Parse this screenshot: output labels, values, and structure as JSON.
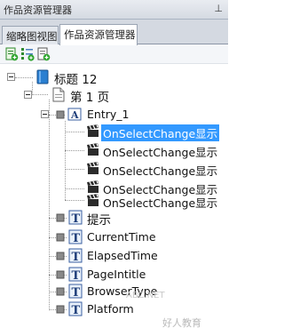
{
  "window": {
    "title": "作品资源管理器",
    "pin_glyph": "ꟷ"
  },
  "tabs": [
    {
      "label": "缩略图视图",
      "active": false
    },
    {
      "label": "作品资源管理器",
      "active": true
    }
  ],
  "toolbar": {
    "buttons": [
      {
        "icon": "add-page-icon"
      },
      {
        "icon": "add-list-icon"
      },
      {
        "icon": "add-doc-icon"
      }
    ]
  },
  "tree": {
    "root": {
      "label": "标题 12",
      "icon": "book-icon"
    },
    "page": {
      "label": "第 1 页",
      "icon": "page-icon"
    },
    "entry": {
      "label": "Entry_1",
      "icon": "text-field-icon"
    },
    "events": [
      {
        "label": "OnSelectChange显示",
        "selected": true
      },
      {
        "label": "OnSelectChange显示",
        "selected": false
      },
      {
        "label": "OnSelectChange显示",
        "selected": false
      },
      {
        "label": "OnSelectChange显示",
        "selected": false
      },
      {
        "label": "OnSelectChange显示",
        "selected": false
      }
    ],
    "variables": [
      {
        "label": "提示"
      },
      {
        "label": "CurrentTime"
      },
      {
        "label": "ElapsedTime"
      },
      {
        "label": "PageIntitle"
      },
      {
        "label": "BrowserType"
      },
      {
        "label": "Platform"
      }
    ]
  },
  "watermark": {
    "text1": "ABC.NET",
    "text2": "好人教育"
  },
  "colors": {
    "selection": "#3399ff",
    "titlebar": "#dfe3ea"
  }
}
